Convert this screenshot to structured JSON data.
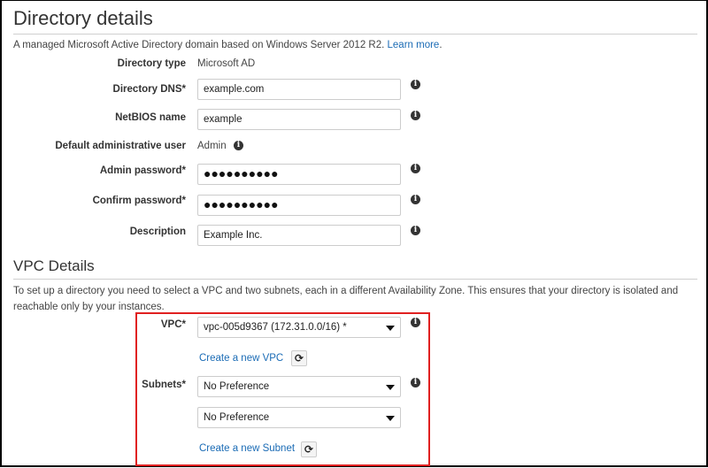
{
  "directory_details": {
    "title": "Directory details",
    "description": "A managed Microsoft Active Directory domain based on Windows Server 2012 R2.",
    "learn_more": "Learn more",
    "learn_more_suffix": ".",
    "fields": {
      "directory_type": {
        "label": "Directory type",
        "value": "Microsoft AD"
      },
      "directory_dns": {
        "label": "Directory DNS*",
        "value": "example.com"
      },
      "netbios_name": {
        "label": "NetBIOS name",
        "value": "example"
      },
      "default_admin_user": {
        "label": "Default administrative user",
        "value": "Admin"
      },
      "admin_password": {
        "label": "Admin password*",
        "value": "●●●●●●●●●●"
      },
      "confirm_password": {
        "label": "Confirm password*",
        "value": "●●●●●●●●●●"
      },
      "description": {
        "label": "Description",
        "value": "Example Inc."
      }
    }
  },
  "vpc_details": {
    "title": "VPC Details",
    "description_line1": "To set up a directory you need to select a VPC and two subnets, each in a different Availability Zone. This ensures that your directory is isolated and",
    "description_line2": "reachable only by your instances.",
    "vpc": {
      "label": "VPC*",
      "selected": "vpc-005d9367 (172.31.0.0/16) *"
    },
    "create_vpc_link": "Create a new VPC",
    "subnets": {
      "label": "Subnets*",
      "selected_1": "No Preference",
      "selected_2": "No Preference"
    },
    "create_subnet_link": "Create a new Subnet"
  },
  "icons": {
    "info": "i",
    "refresh": "⟳"
  },
  "colors": {
    "link": "#1a6bb5",
    "highlight_box": "#e02020"
  }
}
